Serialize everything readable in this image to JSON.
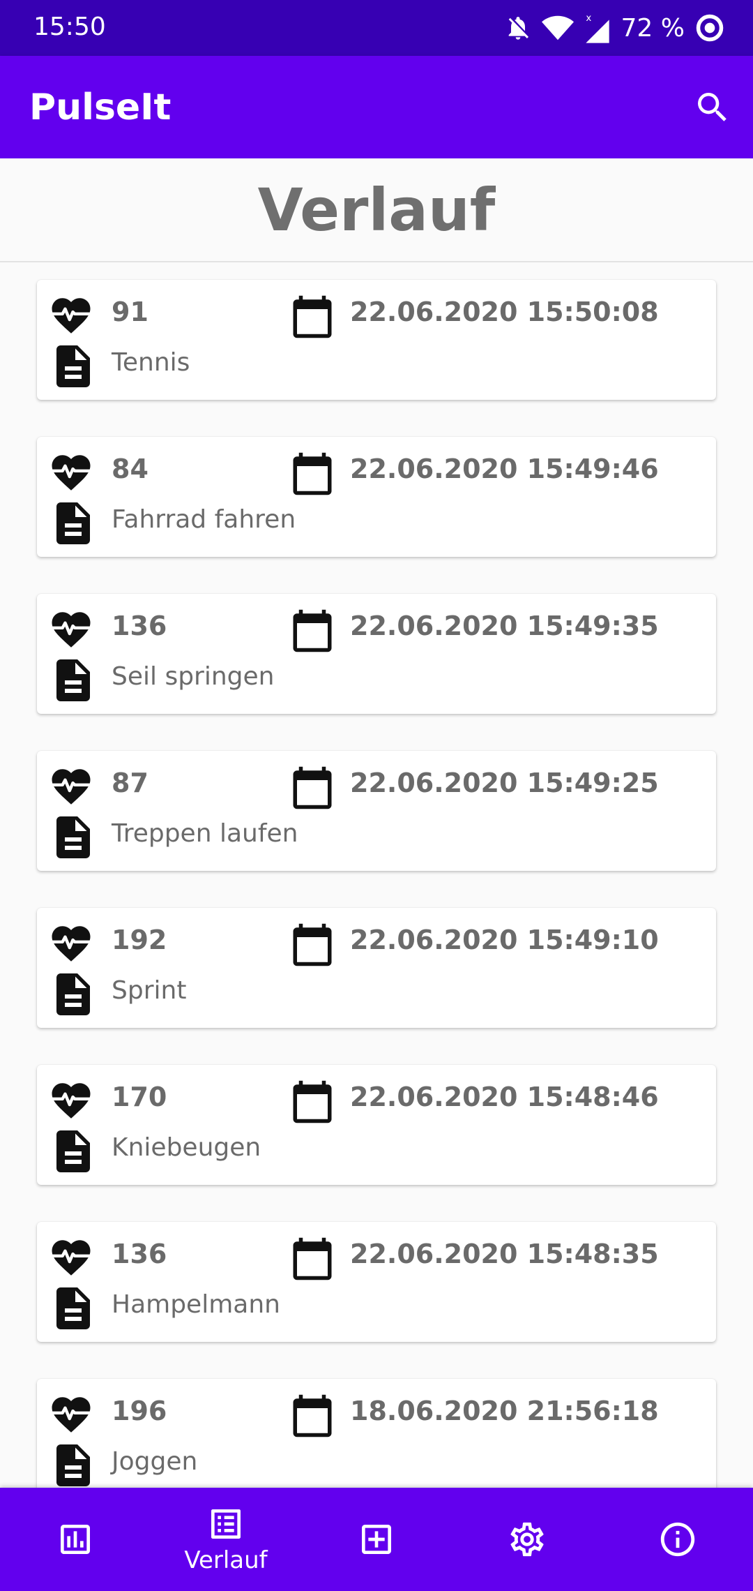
{
  "status_bar": {
    "time": "15:50",
    "battery": "72 %"
  },
  "app_bar": {
    "title": "PulseIt"
  },
  "page": {
    "title": "Verlauf"
  },
  "entries": [
    {
      "pulse": "91",
      "date": "22.06.2020 15:50:08",
      "activity": "Tennis"
    },
    {
      "pulse": "84",
      "date": "22.06.2020 15:49:46",
      "activity": "Fahrrad fahren"
    },
    {
      "pulse": "136",
      "date": "22.06.2020 15:49:35",
      "activity": "Seil springen"
    },
    {
      "pulse": "87",
      "date": "22.06.2020 15:49:25",
      "activity": "Treppen laufen"
    },
    {
      "pulse": "192",
      "date": "22.06.2020 15:49:10",
      "activity": "Sprint"
    },
    {
      "pulse": "170",
      "date": "22.06.2020 15:48:46",
      "activity": "Kniebeugen"
    },
    {
      "pulse": "136",
      "date": "22.06.2020 15:48:35",
      "activity": "Hampelmann"
    },
    {
      "pulse": "196",
      "date": "18.06.2020 21:56:18",
      "activity": "Joggen"
    }
  ],
  "bottom_nav": {
    "items": [
      {
        "icon": "chart-icon",
        "label": ""
      },
      {
        "icon": "list-icon",
        "label": "Verlauf",
        "active": true
      },
      {
        "icon": "add-box-icon",
        "label": ""
      },
      {
        "icon": "gear-icon",
        "label": ""
      },
      {
        "icon": "info-icon",
        "label": ""
      }
    ]
  },
  "colors": {
    "status_bar": "#3700b3",
    "primary": "#6200ee",
    "text_gray": "#6a6a6a"
  }
}
